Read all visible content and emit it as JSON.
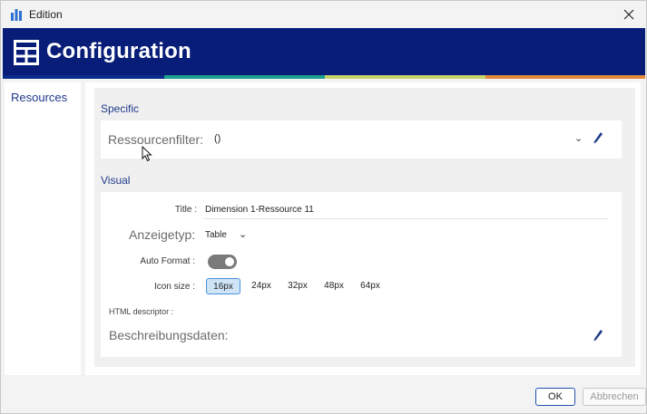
{
  "window": {
    "title": "Edition"
  },
  "header": {
    "title": "Configuration",
    "color": "#071d78",
    "stripe_colors": [
      "#0b2b8a",
      "#1e9e8e",
      "#c6d36a",
      "#e08a3a"
    ]
  },
  "sidebar": {
    "items": [
      {
        "label": "Resources"
      }
    ]
  },
  "specific": {
    "section_label": "Specific",
    "filter_label": "Ressourcenfilter:",
    "filter_value": "()"
  },
  "visual": {
    "section_label": "Visual",
    "title_label": "Title :",
    "title_value": "Dimension 1-Ressource 11",
    "type_label": "Anzeigetyp:",
    "type_value": "Table",
    "auto_format_label": "Auto Format :",
    "auto_format_on": true,
    "icon_size_label": "Icon size :",
    "icon_sizes": [
      "16px",
      "24px",
      "32px",
      "48px",
      "64px"
    ],
    "icon_size_selected": "16px",
    "html_descriptor_label": "HTML descriptor :",
    "description_label": "Beschreibungsdaten:"
  },
  "buttons": {
    "ok": "OK",
    "cancel": "Abbrechen"
  }
}
